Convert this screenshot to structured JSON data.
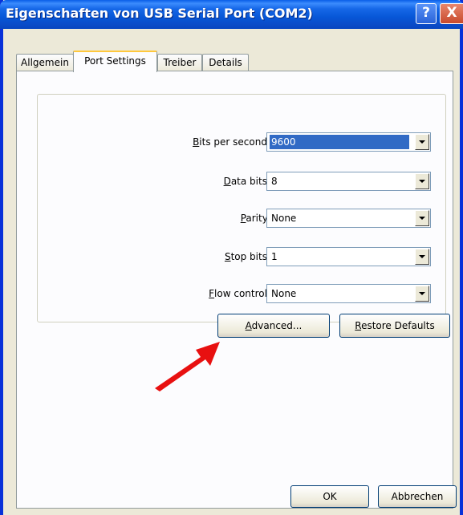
{
  "window": {
    "title": "Eigenschaften von USB Serial Port (COM2)"
  },
  "titlebar_buttons": {
    "help": "?",
    "close": "X"
  },
  "tabs": [
    {
      "label": "Allgemein",
      "active": false
    },
    {
      "label": "Port Settings",
      "active": true
    },
    {
      "label": "Treiber",
      "active": false
    },
    {
      "label": "Details",
      "active": false
    }
  ],
  "fields": [
    {
      "label_u": "B",
      "label_rest": "its per second:",
      "value": "9600",
      "highlighted": true
    },
    {
      "label_u": "D",
      "label_rest": "ata bits:",
      "value": "8",
      "highlighted": false
    },
    {
      "label_u": "P",
      "label_rest": "arity:",
      "value": "None",
      "highlighted": false
    },
    {
      "label_u": "S",
      "label_rest": "top bits:",
      "value": "1",
      "highlighted": false
    },
    {
      "label_u": "F",
      "label_rest": "low control:",
      "value": "None",
      "highlighted": false
    }
  ],
  "buttons": {
    "advanced_u": "A",
    "advanced_rest": "dvanced...",
    "restore_u": "R",
    "restore_rest": "estore Defaults",
    "ok": "OK",
    "cancel": "Abbrechen"
  },
  "annotation": {
    "arrow_color": "#e81010"
  },
  "colors": {
    "titlebar": "#0a5fe8",
    "selection": "#316ac5",
    "window_bg": "#ece9d8"
  }
}
